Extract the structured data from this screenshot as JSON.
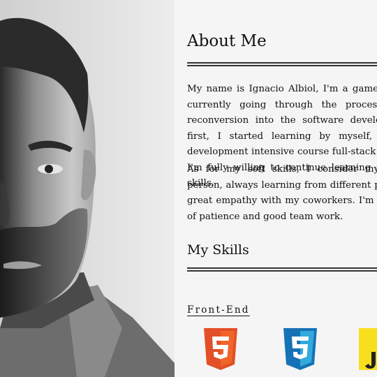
{
  "about": {
    "heading": "About Me",
    "paragraph_1": "My name is Ignacio Albiol, I'm a game & web developer currently going through the process of professional reconversion into the software development sector. At first, I started learning by myself, then did a web development intensive course full-stack program, and now I'm fully willing to continue learning and imporving my skills.",
    "paragraph_2": "As for my soft skills, I consider myself a self-taught person, always learning from different projects and I have great empathy with my coworkers. I'm resilient, have lots of patience and good team work."
  },
  "skills": {
    "heading": "My Skills",
    "front_end_label": "Front-End",
    "icons": [
      "html5-icon",
      "css3-icon",
      "javascript-icon"
    ]
  },
  "colors": {
    "background": "#f5f5f5",
    "html5": "#e34f26",
    "css3": "#1572b6",
    "javascript": "#f7df1e"
  }
}
